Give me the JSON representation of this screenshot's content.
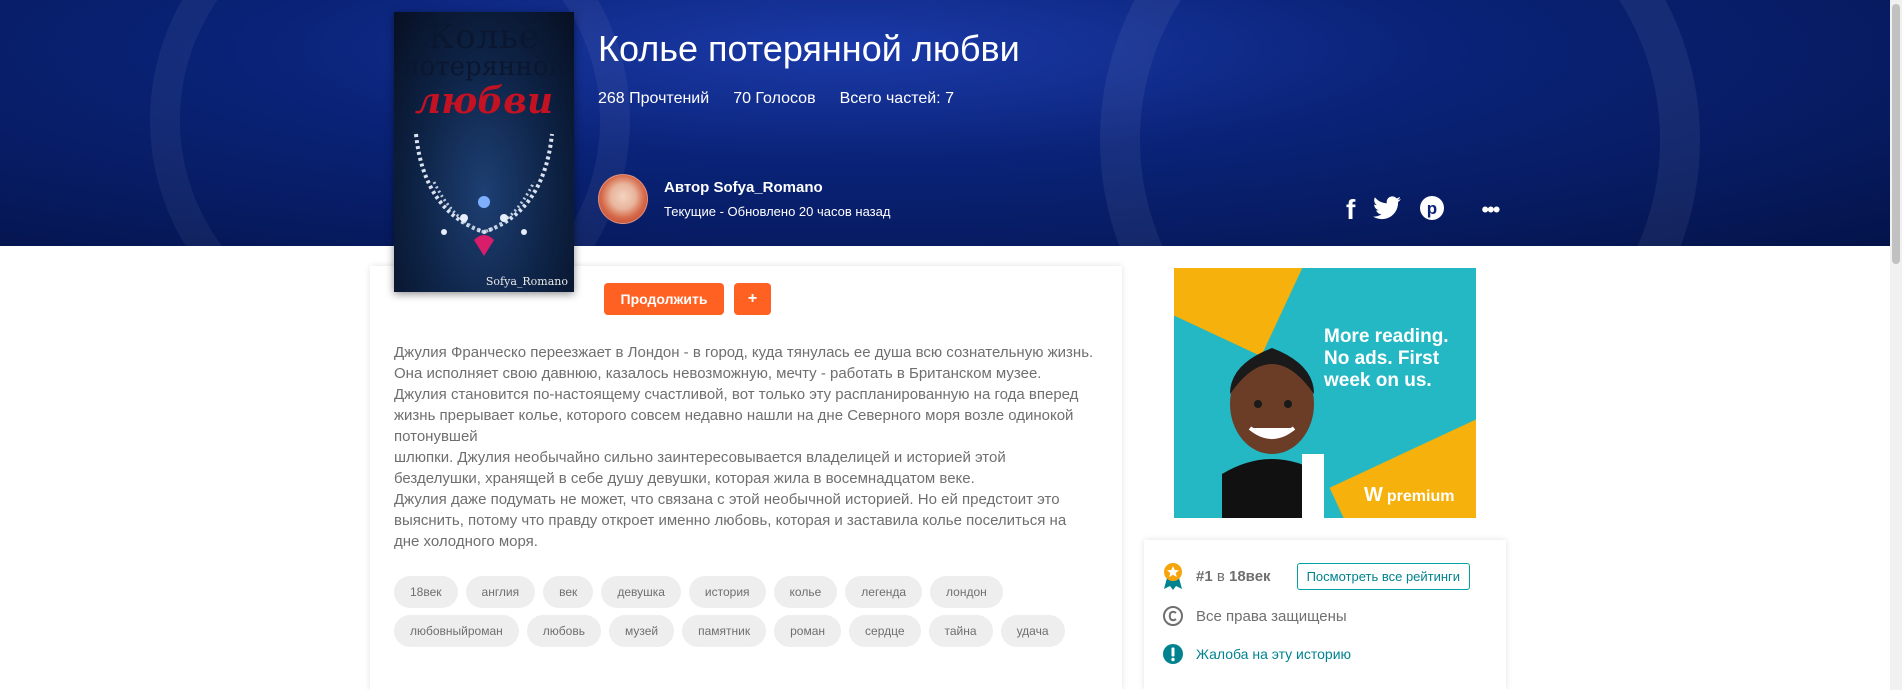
{
  "story": {
    "title": "Колье потерянной любви",
    "reads": "268 Прочтений",
    "votes": "70 Голосов",
    "parts": "Всего частей: 7",
    "author": "Автор Sofya_Romano",
    "status": "Текущие - Обновлено 20 часов назад"
  },
  "cover": {
    "line1": "Колье",
    "line2": "потерянной",
    "line3": "любви",
    "signature": "Sofya_Romano"
  },
  "actions": {
    "continue_label": "Продолжить",
    "add_label": "+"
  },
  "social": {
    "facebook": "f",
    "more": "•••"
  },
  "description": "Джулия Франческо  переезжает в Лондон - в город, куда тянулась ее душа всю сознательную жизнь.\nОна исполняет свою давнюю, казалось невозможную, мечту - работать в Британском музее.\nДжулия становится по-настоящему счастливой, вот только эту распланированную на года вперед\nжизнь прерывает колье, которого совсем недавно нашли на дне Северного моря возле одинокой\nпотонувшей\nшлюпки. Джулия необычайно сильно заинтересовывается владелицей и историей этой\nбезделушки, хранящей в себе душу девушки, которая жила в восемнадцатом веке.\nДжулия даже подумать не может, что связана с этой необычной историей. Но ей предстоит это\nвыяснить, потому что правду откроет именно любовь, которая и заставила колье поселиться на\nдне холодного моря.",
  "tags": [
    "18век",
    "англия",
    "век",
    "девушка",
    "история",
    "колье",
    "легенда",
    "лондон",
    "любовныйроман",
    "любовь",
    "музей",
    "памятник",
    "роман",
    "сердце",
    "тайна",
    "удача"
  ],
  "ad": {
    "text": "More reading. No ads. First week on us.",
    "logo": "premium"
  },
  "ranking": {
    "rank": "#1",
    "in": "в",
    "category": "18век",
    "see_all_label": "Посмотреть все рейтинги"
  },
  "rights": "Все права защищены",
  "report_label": "Жалоба на эту историю",
  "colors": {
    "accent": "#ff6122",
    "teal": "#00838f",
    "hero": "#0a2378"
  }
}
